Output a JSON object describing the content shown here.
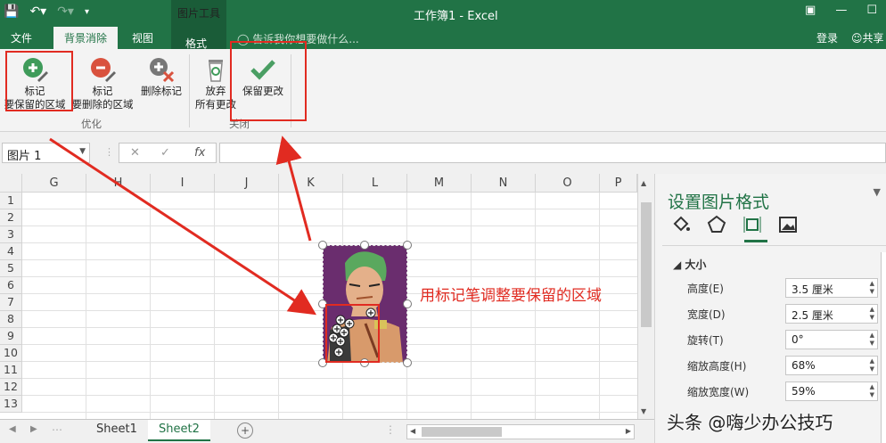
{
  "window": {
    "doc_title": "工作簿1 - Excel",
    "tool_tab": "图片工具"
  },
  "tabs": [
    {
      "label": "文件"
    },
    {
      "label": "背景消除"
    },
    {
      "label": "视图"
    },
    {
      "label": "格式"
    }
  ],
  "tellme": "告诉我你想要做什么...",
  "signin": "登录",
  "share": "共享",
  "ribbon": {
    "mark_keep_1": "标记",
    "mark_keep_2": "要保留的区域",
    "mark_remove_1": "标记",
    "mark_remove_2": "要删除的区域",
    "delete_mark": "删除标记",
    "discard_1": "放弃",
    "discard_2": "所有更改",
    "keep_changes": "保留更改",
    "group_refine": "优化",
    "group_close": "关闭"
  },
  "namebox": "图片 1",
  "fx": "fx",
  "columns": [
    "G",
    "H",
    "I",
    "J",
    "K",
    "L",
    "M",
    "N",
    "O",
    "P"
  ],
  "rows": [
    "1",
    "2",
    "3",
    "4",
    "5",
    "6",
    "7",
    "8",
    "9",
    "10",
    "11",
    "12",
    "13"
  ],
  "annotation": "用标记笔调整要保留的区域",
  "sheets": [
    "Sheet1",
    "Sheet2"
  ],
  "pane": {
    "title": "设置图片格式",
    "section": "大小",
    "rows": [
      {
        "label": "高度(E)",
        "value": "3.5 厘米"
      },
      {
        "label": "宽度(D)",
        "value": "2.5 厘米"
      },
      {
        "label": "旋转(T)",
        "value": "0°"
      },
      {
        "label": "缩放高度(H)",
        "value": "68%"
      },
      {
        "label": "缩放宽度(W)",
        "value": "59%"
      }
    ]
  },
  "watermark": "头条 @嗨少办公技巧",
  "colors": {
    "excel_green": "#217346",
    "annotation_red": "#e12b21"
  }
}
